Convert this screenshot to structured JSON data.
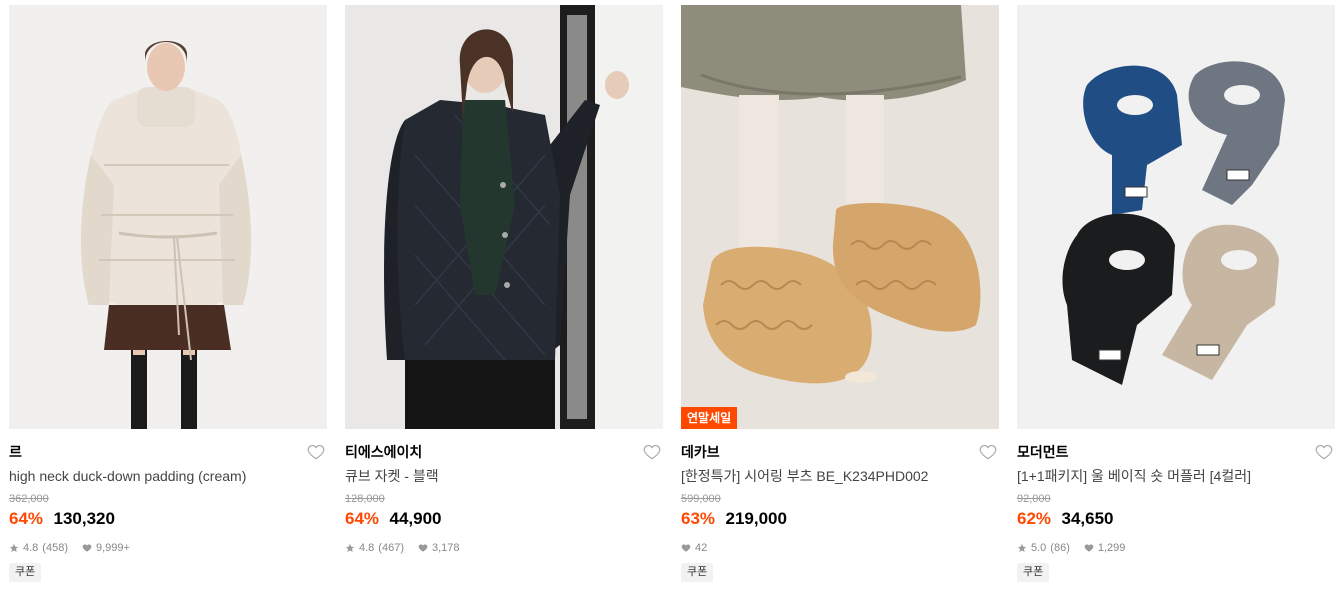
{
  "products": [
    {
      "image_alt": "woman in cream puffer jacket",
      "badge": "",
      "brand": "르",
      "title": "high neck duck-down padding (cream)",
      "original_price": "362,000",
      "discount": "64%",
      "price": "130,320",
      "rating": "4.8",
      "review_count": "(458)",
      "likes": "9,999+",
      "coupon": "쿠폰"
    },
    {
      "image_alt": "woman in black quilted jacket",
      "badge": "",
      "brand": "티에스에이치",
      "title": "큐브 자켓 - 블랙",
      "original_price": "128,000",
      "discount": "64%",
      "price": "44,900",
      "rating": "4.8",
      "review_count": "(467)",
      "likes": "3,178",
      "coupon": ""
    },
    {
      "image_alt": "shearling boots",
      "badge": "연말세일",
      "brand": "데카브",
      "title": "[한정특가] 시어링 부츠 BE_K234PHD002",
      "original_price": "599,000",
      "discount": "63%",
      "price": "219,000",
      "rating": "",
      "review_count": "",
      "likes": "42",
      "coupon": "쿠폰"
    },
    {
      "image_alt": "four knit mufflers",
      "badge": "",
      "brand": "모더먼트",
      "title": "[1+1패키지] 울 베이직 숏 머플러 [4컬러]",
      "original_price": "92,000",
      "discount": "62%",
      "price": "34,650",
      "rating": "5.0",
      "review_count": "(86)",
      "likes": "1,299",
      "coupon": "쿠폰"
    }
  ],
  "colors": {
    "accent": "#ff4800",
    "muted": "#999999"
  },
  "icons": {
    "like": "heart-outline-icon",
    "rating": "star-icon",
    "likes": "heart-filled-icon"
  }
}
